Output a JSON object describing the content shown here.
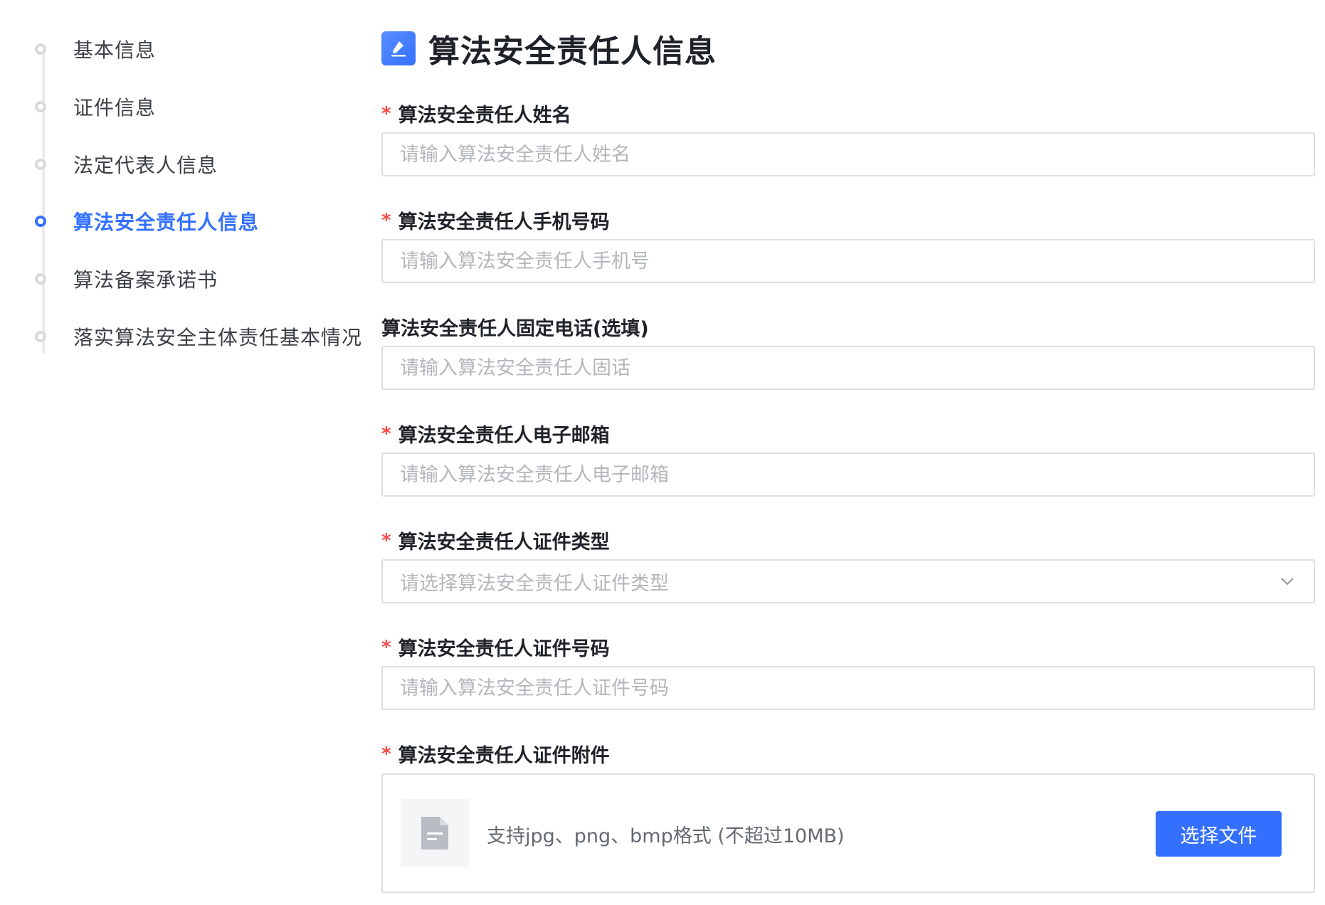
{
  "steps": [
    {
      "label": "基本信息",
      "active": false
    },
    {
      "label": "证件信息",
      "active": false
    },
    {
      "label": "法定代表人信息",
      "active": false
    },
    {
      "label": "算法安全责任人信息",
      "active": true
    },
    {
      "label": "算法备案承诺书",
      "active": false
    },
    {
      "label": "落实算法安全主体责任基本情况",
      "active": false
    }
  ],
  "section": {
    "title": "算法安全责任人信息",
    "icon": "edit-icon"
  },
  "required_mark": "*",
  "fields": {
    "name": {
      "label": "算法安全责任人姓名",
      "placeholder": "请输入算法安全责任人姓名",
      "required": true
    },
    "mobile": {
      "label": "算法安全责任人手机号码",
      "placeholder": "请输入算法安全责任人手机号",
      "required": true
    },
    "landline": {
      "label": "算法安全责任人固定电话(选填)",
      "placeholder": "请输入算法安全责任人固话",
      "required": false
    },
    "email": {
      "label": "算法安全责任人电子邮箱",
      "placeholder": "请输入算法安全责任人电子邮箱",
      "required": true
    },
    "id_type": {
      "label": "算法安全责任人证件类型",
      "placeholder": "请选择算法安全责任人证件类型",
      "required": true
    },
    "id_number": {
      "label": "算法安全责任人证件号码",
      "placeholder": "请输入算法安全责任人证件号码",
      "required": true
    },
    "attachment": {
      "label": "算法安全责任人证件附件",
      "hint": "支持jpg、png、bmp格式 (不超过10MB)",
      "button": "选择文件",
      "required": true
    }
  },
  "colors": {
    "accent": "#3370ff",
    "required": "#f54a45",
    "inactive_dot": "#d9d9d9"
  }
}
